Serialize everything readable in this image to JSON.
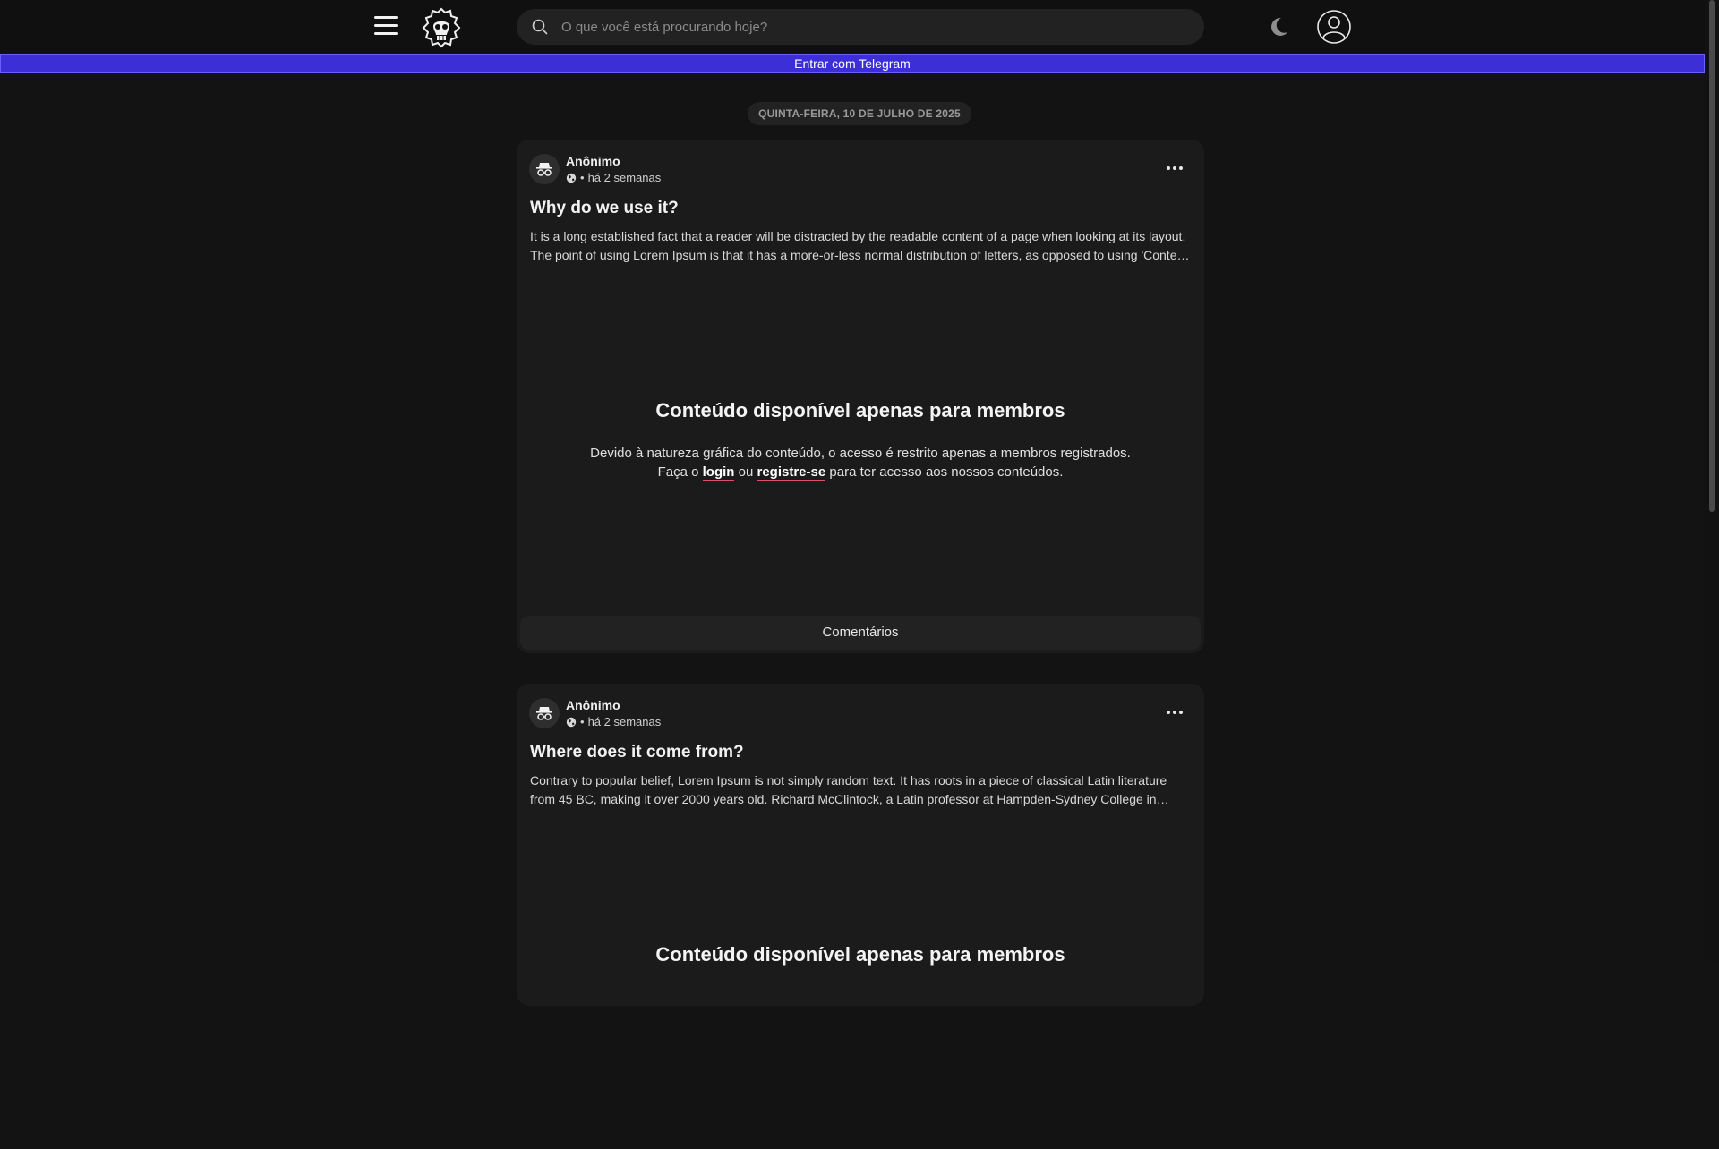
{
  "header": {
    "search_placeholder": "O que você está procurando hoje?"
  },
  "telegram_bar": {
    "label": "Entrar com Telegram"
  },
  "feed": {
    "date_label": "QUINTA-FEIRA, 10 DE JULHO DE 2025",
    "posts": [
      {
        "author": "Anônimo",
        "time": "há 2 semanas",
        "title": "Why do we use it?",
        "excerpt": "It is a long established fact that a reader will be distracted by the readable content of a page when looking at its layout. The point of using Lorem Ipsum is that it has a more-or-less normal distribution of letters, as opposed to using 'Content here, content here', making it look like readable English.",
        "locked_title": "Conteúdo disponível apenas para membros",
        "locked_line1": "Devido à natureza gráfica do conteúdo, o acesso é restrito apenas a membros registrados.",
        "locked_prefix": "Faça o",
        "login_label": "login",
        "or_label": "ou",
        "register_label": "registre-se",
        "locked_suffix": "para ter acesso aos nossos conteúdos.",
        "comments_label": "Comentários"
      },
      {
        "author": "Anônimo",
        "time": "há 2 semanas",
        "title": "Where does it come from?",
        "excerpt": "Contrary to popular belief, Lorem Ipsum is not simply random text. It has roots in a piece of classical Latin literature from 45 BC, making it over 2000 years old. Richard McClintock, a Latin professor at Hampden-Sydney College in Virginia, looked up one of the more obscure Latin words.",
        "locked_title": "Conteúdo disponível apenas para membros"
      }
    ]
  },
  "icons": {
    "menu": "hamburger-icon",
    "logo": "skull-logo",
    "search": "search-icon",
    "theme": "moon-icon",
    "account": "user-icon",
    "avatar": "incognito-icon",
    "visibility": "globe-icon",
    "more": "ellipsis-icon"
  },
  "colors": {
    "background": "#131313",
    "card": "#1b1b1b",
    "telegram_bar": "#3c2fd8",
    "link_underline": "#e14b6b"
  }
}
